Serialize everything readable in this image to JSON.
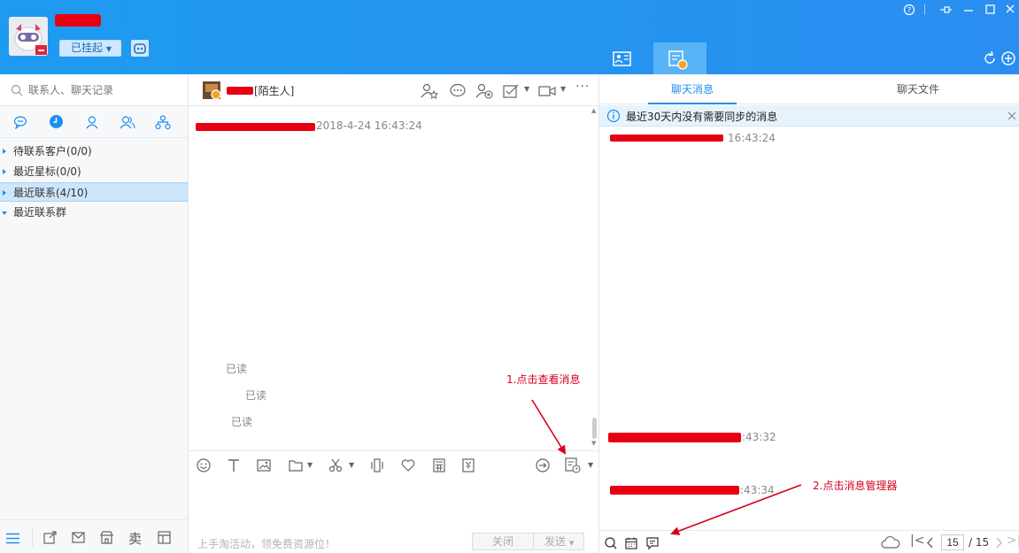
{
  "app": {
    "status_label": "已挂起",
    "colors": {
      "brand": "#1e9bf0",
      "annotation": "#d7001e",
      "redaction": "#e60012"
    }
  },
  "window_controls": [
    {
      "name": "help-icon"
    },
    {
      "name": "pin-icon"
    },
    {
      "name": "minimize-icon"
    },
    {
      "name": "maximize-icon"
    },
    {
      "name": "close-icon"
    }
  ],
  "top_tabs": [
    {
      "name": "contact-card-icon"
    },
    {
      "name": "message-manager-icon",
      "active": true
    }
  ],
  "sidebar": {
    "search_placeholder": "联系人、聊天记录",
    "tabs": [
      "chat-bubble-icon",
      "clock-icon",
      "user-icon",
      "group-icon",
      "org-icon"
    ],
    "items": [
      {
        "label": "待联系客户(0/0)",
        "expanded": false
      },
      {
        "label": "最近星标(0/0)",
        "expanded": false
      },
      {
        "label": "最近联系(4/10)",
        "expanded": false,
        "selected": true
      },
      {
        "label": "最近联系群",
        "expanded": true
      }
    ],
    "bottom_icons": [
      "menu-icon",
      "share-icon",
      "mail-icon",
      "store-icon",
      "sell-icon",
      "layout-icon"
    ],
    "sell_label": "卖"
  },
  "chat": {
    "contact_suffix": "[陌生人]",
    "first_timestamp": "2018-4-24 16:43:24",
    "read_labels": [
      "已读",
      "已读",
      "已读"
    ],
    "footer_promo": "上手淘活动，领免费资源位！",
    "close_label": "关闭",
    "send_label": "发送"
  },
  "right_panel": {
    "tabs": [
      {
        "label": "聊天消息",
        "active": true
      },
      {
        "label": "聊天文件",
        "active": false
      }
    ],
    "notice": "最近30天内没有需要同步的消息",
    "messages": [
      {
        "time": "16:43:24"
      },
      {
        "time": ":43:32"
      },
      {
        "time": ":43:34"
      }
    ],
    "pager": {
      "current": "15",
      "total": "/ 15"
    }
  },
  "annotations": {
    "step1": "1.点击查看消息",
    "step2": "2.点击消息管理器"
  }
}
